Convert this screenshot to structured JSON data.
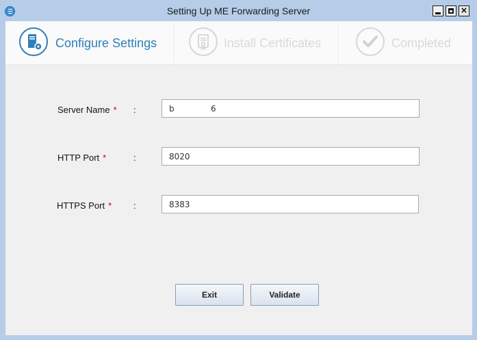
{
  "window": {
    "title": "Setting Up ME Forwarding Server",
    "controls": [
      "minimize-icon",
      "maximize-icon",
      "close-icon"
    ],
    "close_glyph": "×"
  },
  "steps": [
    {
      "label": "Configure Settings",
      "icon": "server-settings-icon",
      "state": "active",
      "color": "#2f7fb8"
    },
    {
      "label": "Install Certificates",
      "icon": "certificate-icon",
      "state": "pending",
      "color": "#d9d9d9"
    },
    {
      "label": "Completed",
      "icon": "checkmark-icon",
      "state": "pending",
      "color": "#d9d9d9"
    }
  ],
  "form": {
    "separator": ":",
    "required_marker": "*",
    "fields": [
      {
        "label": "Server Name",
        "value": "b              6"
      },
      {
        "label": "HTTP Port",
        "value": "8020"
      },
      {
        "label": "HTTPS Port",
        "value": "8383"
      }
    ]
  },
  "buttons": {
    "exit": "Exit",
    "validate": "Validate"
  }
}
